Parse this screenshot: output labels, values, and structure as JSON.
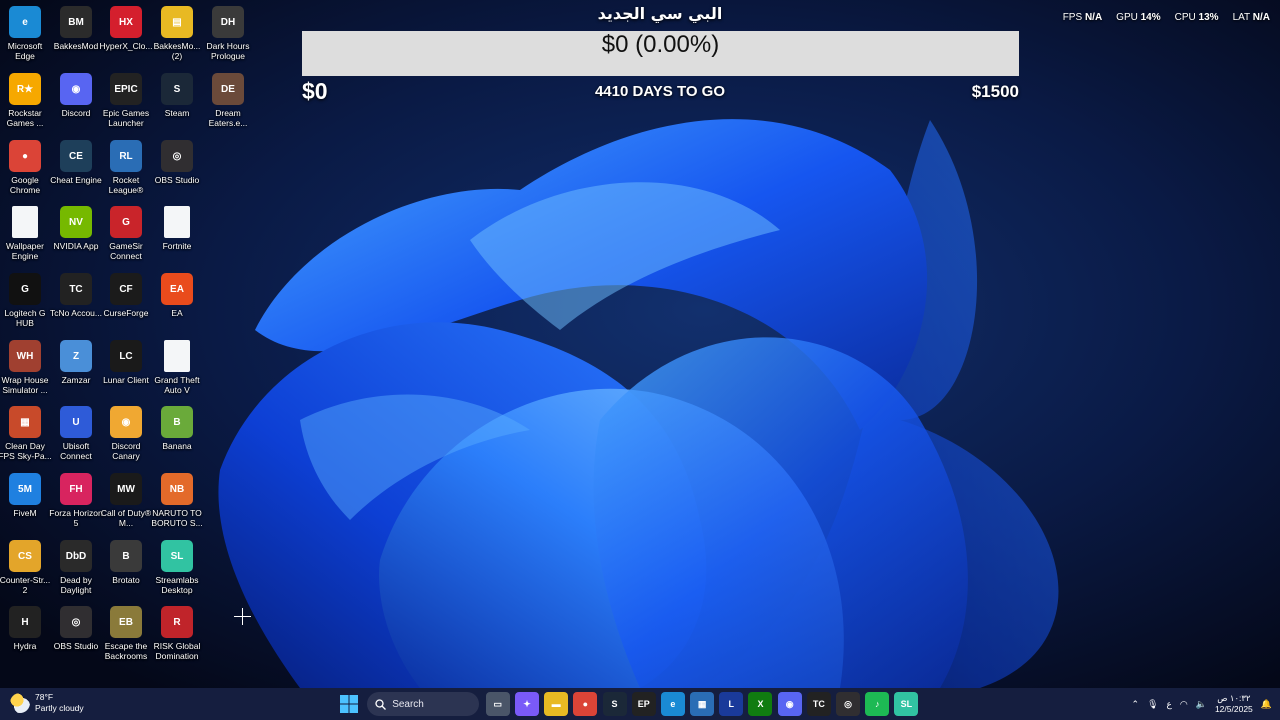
{
  "desktop_icons": [
    {
      "label": "Microsoft Edge",
      "glyph": "e",
      "color": "#1a8ad4"
    },
    {
      "label": "BakkesMod",
      "glyph": "BM",
      "color": "#2b2b2b"
    },
    {
      "label": "HyperX_Clo...",
      "glyph": "HX",
      "color": "#d41f2d"
    },
    {
      "label": "BakkesMo... (2)",
      "glyph": "▤",
      "color": "#e8b923"
    },
    {
      "label": "Dark Hours Prologue",
      "glyph": "DH",
      "color": "#3a3a3a"
    },
    {
      "label": "Rockstar Games ...",
      "glyph": "R★",
      "color": "#f6a800"
    },
    {
      "label": "Discord",
      "glyph": "◉",
      "color": "#5865f2"
    },
    {
      "label": "Epic Games Launcher",
      "glyph": "EPIC",
      "color": "#222222"
    },
    {
      "label": "Steam",
      "glyph": "S",
      "color": "#1b2838"
    },
    {
      "label": "Dream Eaters.e...",
      "glyph": "DE",
      "color": "#6b4a3a"
    },
    {
      "label": "Google Chrome",
      "glyph": "●",
      "color": "#db4437"
    },
    {
      "label": "Cheat Engine",
      "glyph": "CE",
      "color": "#1e3f5a"
    },
    {
      "label": "Rocket League®",
      "glyph": "RL",
      "color": "#2a6db5"
    },
    {
      "label": "OBS Studio",
      "glyph": "◎",
      "color": "#302e31"
    },
    {
      "label": "",
      "glyph": "",
      "color": ""
    },
    {
      "label": "Wallpaper Engine",
      "glyph": "",
      "color": "file"
    },
    {
      "label": "NVIDIA App",
      "glyph": "NV",
      "color": "#76b900"
    },
    {
      "label": "GameSir Connect",
      "glyph": "G",
      "color": "#c9242a"
    },
    {
      "label": "Fortnite",
      "glyph": "",
      "color": "file"
    },
    {
      "label": "",
      "glyph": "",
      "color": ""
    },
    {
      "label": "Logitech G HUB",
      "glyph": "G",
      "color": "#111111"
    },
    {
      "label": "TcNo Accou...",
      "glyph": "TC",
      "color": "#222222"
    },
    {
      "label": "CurseForge",
      "glyph": "CF",
      "color": "#1b1b1b"
    },
    {
      "label": "EA",
      "glyph": "EA",
      "color": "#e94b1c"
    },
    {
      "label": "",
      "glyph": "",
      "color": ""
    },
    {
      "label": "Wrap House Simulator ...",
      "glyph": "WH",
      "color": "#a04030"
    },
    {
      "label": "Zamzar",
      "glyph": "Z",
      "color": "#4a8fd8"
    },
    {
      "label": "Lunar Client",
      "glyph": "LC",
      "color": "#1a1a1a"
    },
    {
      "label": "Grand Theft Auto V",
      "glyph": "",
      "color": "file"
    },
    {
      "label": "",
      "glyph": "",
      "color": ""
    },
    {
      "label": "Clean Day FPS Sky-Pa...",
      "glyph": "▦",
      "color": "#c84a2a"
    },
    {
      "label": "Ubisoft Connect",
      "glyph": "U",
      "color": "#2e5bd8"
    },
    {
      "label": "Discord Canary",
      "glyph": "◉",
      "color": "#f0a832"
    },
    {
      "label": "Banana",
      "glyph": "B",
      "color": "#6aaa3a"
    },
    {
      "label": "",
      "glyph": "",
      "color": ""
    },
    {
      "label": "FiveM",
      "glyph": "5M",
      "color": "#1f80e0"
    },
    {
      "label": "Forza Horizon 5",
      "glyph": "FH",
      "color": "#d8245f"
    },
    {
      "label": "Call of Duty® M...",
      "glyph": "MW",
      "color": "#1a1a1a"
    },
    {
      "label": "NARUTO TO BORUTO S...",
      "glyph": "NB",
      "color": "#e36a2a"
    },
    {
      "label": "",
      "glyph": "",
      "color": ""
    },
    {
      "label": "Counter-Str... 2",
      "glyph": "CS",
      "color": "#e3a52a"
    },
    {
      "label": "Dead by Daylight",
      "glyph": "DbD",
      "color": "#2a2a2a"
    },
    {
      "label": "Brotato",
      "glyph": "B",
      "color": "#3a3a3a"
    },
    {
      "label": "Streamlabs Desktop",
      "glyph": "SL",
      "color": "#31c3a2"
    },
    {
      "label": "",
      "glyph": "",
      "color": ""
    },
    {
      "label": "Hydra",
      "glyph": "H",
      "color": "#222222"
    },
    {
      "label": "OBS Studio",
      "glyph": "◎",
      "color": "#302e31"
    },
    {
      "label": "Escape the Backrooms",
      "glyph": "EB",
      "color": "#8a7a3a"
    },
    {
      "label": "RISK Global Domination",
      "glyph": "R",
      "color": "#c0242a"
    },
    {
      "label": "",
      "glyph": "",
      "color": ""
    }
  ],
  "goal": {
    "title": "البي سي الجديد",
    "amount_text": "$0 (0.00%)",
    "progress_fraction": 0,
    "min_label": "$0",
    "days_text": "4410 DAYS TO GO",
    "max_label": "$1500",
    "bar_color": "#dddddd",
    "fill_color": "#28b44a"
  },
  "stats": [
    {
      "label": "FPS",
      "value": "N/A"
    },
    {
      "label": "GPU",
      "value": "14%"
    },
    {
      "label": "CPU",
      "value": "13%"
    },
    {
      "label": "LAT",
      "value": "N/A"
    }
  ],
  "taskbar": {
    "weather_temp": "78°F",
    "weather_desc": "Partly cloudy",
    "search_label": "Search",
    "apps": [
      {
        "name": "explorer",
        "glyph": "▭",
        "color": "#4a5568"
      },
      {
        "name": "copilot",
        "glyph": "✦",
        "color": "#7a5af8"
      },
      {
        "name": "file-explorer",
        "glyph": "▬",
        "color": "#e8b923"
      },
      {
        "name": "chrome",
        "glyph": "●",
        "color": "#db4437"
      },
      {
        "name": "steam",
        "glyph": "S",
        "color": "#1b2838"
      },
      {
        "name": "epic-games",
        "glyph": "EP",
        "color": "#222222"
      },
      {
        "name": "edge",
        "glyph": "e",
        "color": "#1a8ad4"
      },
      {
        "name": "store",
        "glyph": "▦",
        "color": "#2a6db5"
      },
      {
        "name": "lunar-client",
        "glyph": "L",
        "color": "#1a3a9a"
      },
      {
        "name": "xbox",
        "glyph": "X",
        "color": "#107c10"
      },
      {
        "name": "discord",
        "glyph": "◉",
        "color": "#5865f2"
      },
      {
        "name": "tcno",
        "glyph": "TC",
        "color": "#222222"
      },
      {
        "name": "obs",
        "glyph": "◎",
        "color": "#302e31"
      },
      {
        "name": "spotify",
        "glyph": "♪",
        "color": "#1db954"
      },
      {
        "name": "streamlabs",
        "glyph": "SL",
        "color": "#31c3a2"
      }
    ],
    "tray_lang": "ع",
    "clock_time": "١٠:٣٢ ص",
    "clock_date": "12/5/2025"
  }
}
